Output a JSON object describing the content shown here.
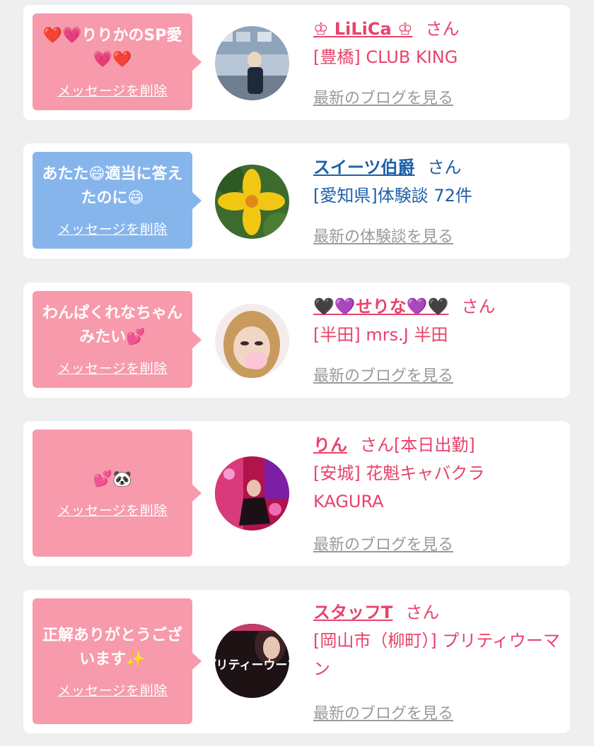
{
  "items": [
    {
      "message": "❤️💗りりかのSP愛💗❤️",
      "delete_label": "メッセージを削除",
      "name": "♔ LiLiCa ♔",
      "san": "さん",
      "shop": "[豊橋] CLUB KING",
      "blog_link": "最新のブログを見る"
    },
    {
      "message": "あたた😄適当に答えたのに😄",
      "delete_label": "メッセージを削除",
      "name": "スイーツ伯爵",
      "san": "さん",
      "shop": "[愛知県]体験談 72件",
      "blog_link": "最新の体験談を見る"
    },
    {
      "message": "わんぱくれなちゃんみたい💕",
      "delete_label": "メッセージを削除",
      "name": "🖤💜せりな💜🖤",
      "san": "さん",
      "shop": "[半田] mrs.J 半田",
      "blog_link": "最新のブログを見る"
    },
    {
      "message": "💕🐼",
      "delete_label": "メッセージを削除",
      "name": "りん",
      "san": "さん",
      "status": "[本日出勤]",
      "shop": "[安城] 花魁キャバクラKAGURA",
      "blog_link": "最新のブログを見る"
    },
    {
      "message": "正解ありがとうございます✨",
      "delete_label": "メッセージを削除",
      "name": "スタッフT",
      "san": "さん",
      "shop": "[岡山市（柳町）] プリティウーマン",
      "blog_link": "最新のブログを見る",
      "avatar_text": "プリティーウーマ"
    }
  ],
  "colors": {
    "pink_bubble": "#f79aac",
    "blue_bubble": "#86b5ec",
    "pink_text": "#e8426b",
    "blue_text": "#1e5fa8",
    "link_gray": "#9a9a9a"
  }
}
